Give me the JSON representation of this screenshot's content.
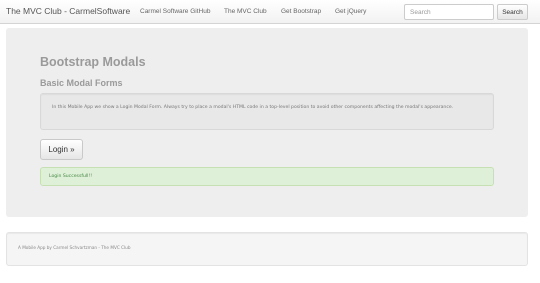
{
  "navbar": {
    "brand": "The MVC Club - CarmelSoftware",
    "links": [
      {
        "label": "Carmel Software GitHub"
      },
      {
        "label": "The MVC Club"
      },
      {
        "label": "Get Bootstrap"
      },
      {
        "label": "Get jQuery"
      }
    ],
    "search_placeholder": "Search",
    "search_button": "Search"
  },
  "main": {
    "title": "Bootstrap Modals",
    "subtitle": "Basic Modal Forms",
    "info_text": "In this Mobile App we show a Login Modal Form. Always try to place a modal's HTML code in a top-level position to avoid other components affecting the modal's appearance.",
    "login_button": "Login »",
    "alert_text": "Login Successfull!!"
  },
  "footer": {
    "text": "A Mobile App by Carmel Schvartzman - The MVC Club"
  },
  "colors": {
    "jumbotron_bg": "#eeeeee",
    "title_gray": "#9a9a9a",
    "success_bg": "#dff0d8",
    "success_text": "#468847"
  }
}
